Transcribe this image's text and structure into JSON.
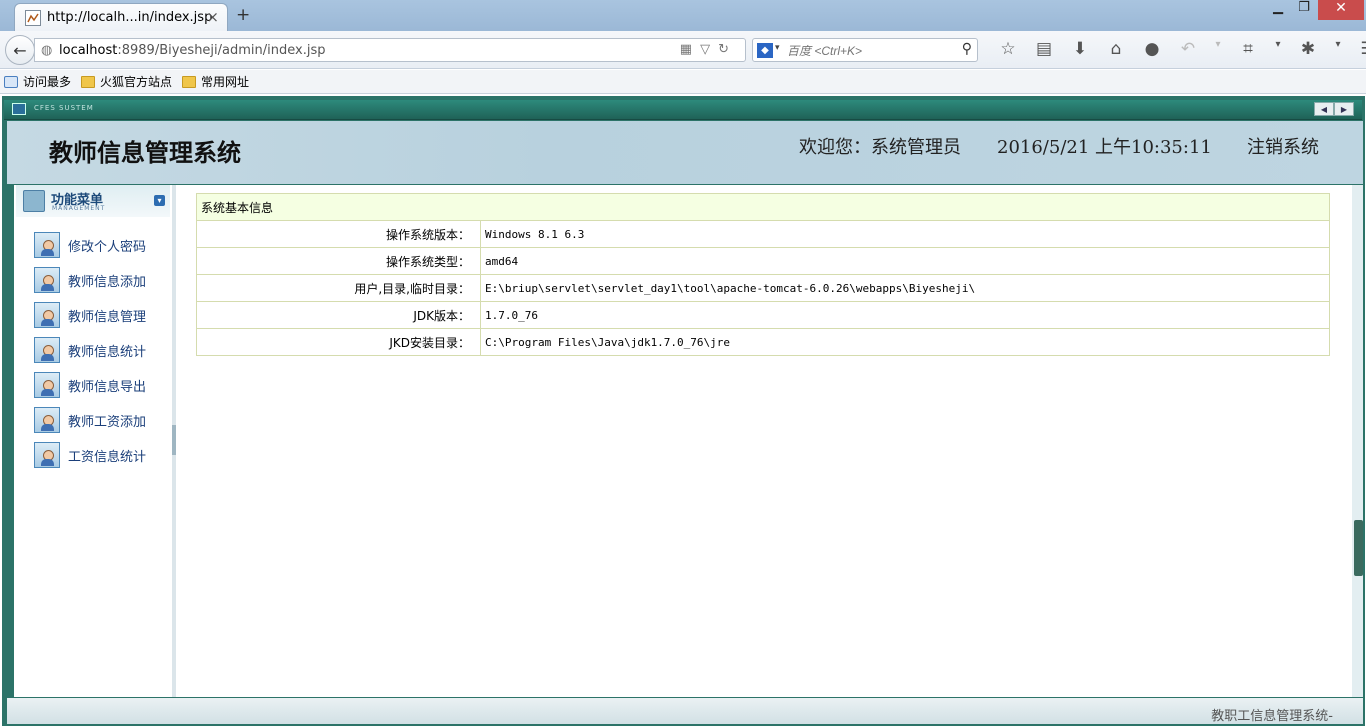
{
  "browser": {
    "tab_title": "http://localh...in/index.jsp",
    "tab_close": "×",
    "new_tab": "+",
    "window_controls": {
      "minimize": "▁",
      "maximize": "❐",
      "close": "✕"
    },
    "url_host": "localhost",
    "url_rest": ":8989/Biyesheji/admin/index.jsp",
    "search_engine_icon": "baidu-paw-icon",
    "search_placeholder": "百度 <Ctrl+K>",
    "toolbar_icons": [
      "star-icon",
      "reading-list-icon",
      "download-icon",
      "home-icon",
      "chat-icon",
      "undo-icon",
      "crop-icon",
      "extension-icon",
      "menu-icon"
    ],
    "bookmarks": [
      {
        "label": "访问最多",
        "icon": "most-visited-icon"
      },
      {
        "label": "火狐官方站点",
        "icon": "folder-icon"
      },
      {
        "label": "常用网址",
        "icon": "folder-icon"
      }
    ]
  },
  "app": {
    "system_badge": "CFES SUSTEM",
    "title": "教师信息管理系统",
    "welcome": "欢迎您：系统管理员",
    "datetime": "2016/5/21 上午10:35:11",
    "logout": "注销系统",
    "footer": "教职工信息管理系统-"
  },
  "sidebar": {
    "title": "功能菜单",
    "subtitle": "MANAGEMENT",
    "items": [
      {
        "label": "修改个人密码"
      },
      {
        "label": "教师信息添加"
      },
      {
        "label": "教师信息管理"
      },
      {
        "label": "教师信息统计"
      },
      {
        "label": "教师信息导出"
      },
      {
        "label": "教师工资添加"
      },
      {
        "label": "工资信息统计"
      }
    ]
  },
  "sysinfo": {
    "header": "系统基本信息",
    "rows": [
      {
        "label": "操作系统版本：",
        "value": "Windows 8.1  6.3"
      },
      {
        "label": "操作系统类型：",
        "value": "amd64"
      },
      {
        "label": "用户,目录,临时目录：",
        "value": "E:\\briup\\servlet\\servlet_day1\\tool\\apache-tomcat-6.0.26\\webapps\\Biyesheji\\"
      },
      {
        "label": "JDK版本：",
        "value": "1.7.0_76"
      },
      {
        "label": "JKD安装目录：",
        "value": "C:\\Program Files\\Java\\jdk1.7.0_76\\jre"
      }
    ]
  }
}
